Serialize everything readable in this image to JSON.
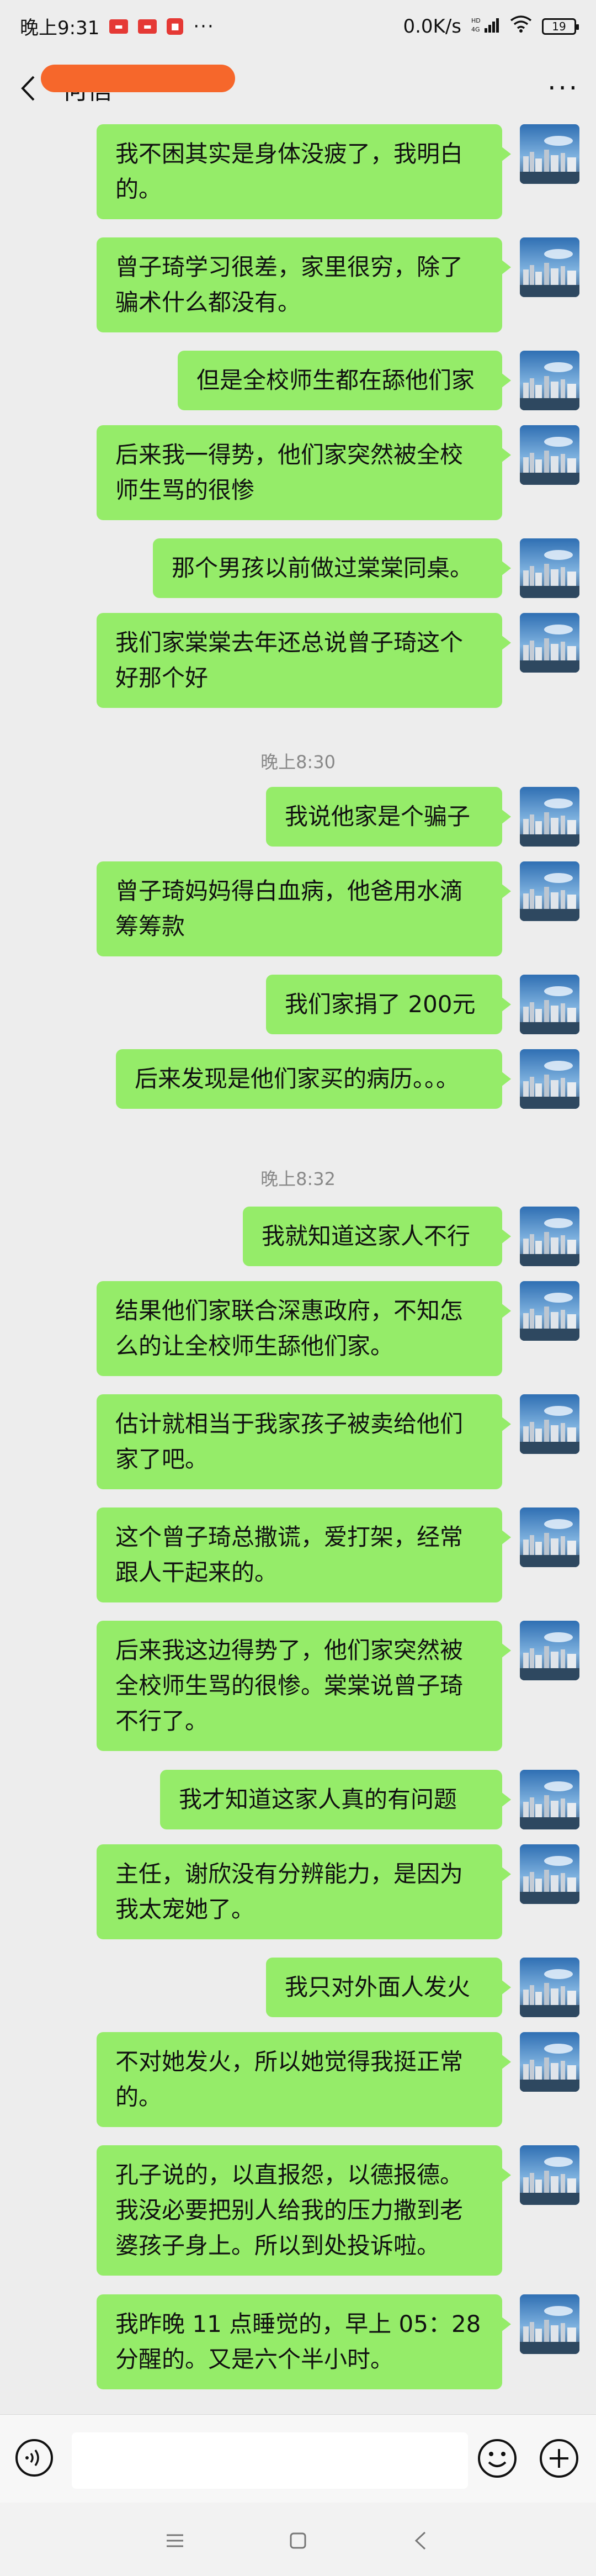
{
  "status_bar": {
    "time": "晚上9:31",
    "network_speed": "0.0K/s",
    "network_type": "HD 4G",
    "battery": "19"
  },
  "header": {
    "title": "何信"
  },
  "messages": [
    {
      "text": "我不困其实是身体没疲了，我明白的。",
      "lines": [
        "我不困其实是身体没疲了，我明白",
        "的。"
      ]
    },
    {
      "text": "曾子琦学习很差，家里很穷，除了骗术什么都没有。",
      "lines": [
        "曾子琦学习很差，家里很穷，除了",
        "骗术什么都没有。"
      ]
    },
    {
      "text": "但是全校师生都在舔他们家",
      "lines": [
        "但是全校师生都在舔他们家"
      ]
    },
    {
      "text": "后来我一得势，他们家突然被全校师生骂的很惨",
      "lines": [
        "后来我一得势，他们家突然被全校",
        "师生骂的很惨"
      ]
    },
    {
      "text": "那个男孩以前做过棠棠同桌。",
      "lines": [
        "那个男孩以前做过棠棠同桌。"
      ]
    },
    {
      "text": "我们家棠棠去年还总说曾子琦这个好那个好",
      "lines": [
        "我们家棠棠去年还总说曾子琦这个",
        "好那个好"
      ]
    },
    {
      "text": "我说他家是个骗子",
      "lines": [
        "我说他家是个骗子"
      ]
    },
    {
      "text": "曾子琦妈妈得白血病，他爸用水滴筹筹款",
      "lines": [
        "曾子琦妈妈得白血病，他爸用水滴",
        "筹筹款"
      ]
    },
    {
      "text": "我们家捐了 200元",
      "lines": [
        "我们家捐了 200元"
      ]
    },
    {
      "text": "后来发现是他们家买的病历。。。",
      "lines": [
        "后来发现是他们家买的病历。。。"
      ]
    },
    {
      "text": "我就知道这家人不行",
      "lines": [
        "我就知道这家人不行"
      ]
    },
    {
      "text": "结果他们家联合深惠政府，不知怎么的让全校师生舔他们家。",
      "lines": [
        "结果他们家联合深惠政府，不知怎",
        "么的让全校师生舔他们家。"
      ]
    },
    {
      "text": "估计就相当于我家孩子被卖给他们家了吧。",
      "lines": [
        "估计就相当于我家孩子被卖给他们",
        "家了吧。"
      ]
    },
    {
      "text": "这个曾子琦总撒谎，爱打架，经常跟人干起来的。",
      "lines": [
        "这个曾子琦总撒谎，爱打架，经常",
        "跟人干起来的。"
      ]
    },
    {
      "text": "后来我这边得势了，他们家突然被全校师生骂的很惨。棠棠说曾子琦不行了。",
      "lines": [
        "后来我这边得势了，他们家突然被",
        "全校师生骂的很惨。棠棠说曾子琦",
        "不行了。"
      ]
    },
    {
      "text": "我才知道这家人真的有问题",
      "lines": [
        "我才知道这家人真的有问题"
      ]
    },
    {
      "text": "主任，谢欣没有分辨能力，是因为我太宠她了。",
      "lines": [
        "主任，谢欣没有分辨能力，是因为",
        "我太宠她了。"
      ]
    },
    {
      "text": "我只对外面人发火",
      "lines": [
        "我只对外面人发火"
      ]
    },
    {
      "text": "不对她发火，所以她觉得我挺正常的。",
      "lines": [
        "不对她发火，所以她觉得我挺正常",
        "的。"
      ]
    },
    {
      "text": "孔子说的，以直报怨，以德报德。我没必要把别人给我的压力撒到老婆孩子身上。所以到处投诉啦。",
      "lines": [
        "孔子说的，以直报怨，以德报德。",
        "我没必要把别人给我的压力撒到老",
        "婆孩子身上。所以到处投诉啦。"
      ]
    },
    {
      "text": "我昨晚 11 点睡觉的，早上 05：28 分醒的。又是六个半小时。",
      "lines": [
        "我昨晚 11 点睡觉的，早上 05：28",
        "分醒的。又是六个半小时。"
      ]
    }
  ],
  "timestamps": [
    "晚上8:30",
    "晚上8:32"
  ],
  "input": {
    "placeholder": ""
  }
}
